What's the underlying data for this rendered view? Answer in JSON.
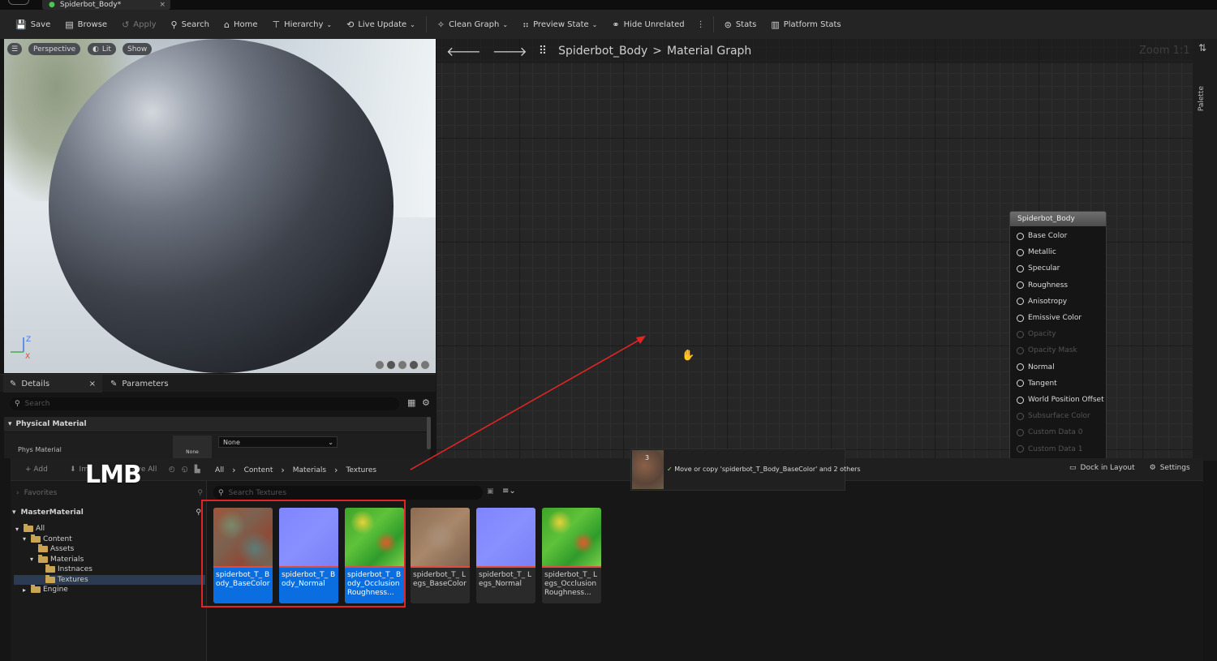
{
  "window": {
    "tab_title": "Spiderbot_Body*",
    "tab_close": "×"
  },
  "toolbar": [
    {
      "label": "Save",
      "icon": "save-icon",
      "enabled": true
    },
    {
      "label": "Browse",
      "icon": "browse-icon",
      "enabled": true
    },
    {
      "label": "Apply",
      "icon": "apply-icon",
      "enabled": false
    },
    {
      "label": "Search",
      "icon": "search-icon",
      "enabled": true
    },
    {
      "label": "Home",
      "icon": "home-icon",
      "enabled": true
    },
    {
      "label": "Hierarchy",
      "icon": "hierarchy-icon",
      "enabled": true,
      "dropdown": true
    },
    {
      "label": "Live Update",
      "icon": "live-update-icon",
      "enabled": true,
      "dropdown": true
    },
    {
      "label": "Clean Graph",
      "icon": "clean-graph-icon",
      "enabled": true,
      "dropdown": true
    },
    {
      "label": "Preview State",
      "icon": "preview-state-icon",
      "enabled": true,
      "dropdown": true
    },
    {
      "label": "Hide Unrelated",
      "icon": "hide-unrelated-icon",
      "enabled": true
    },
    {
      "label": "Stats",
      "icon": "stats-icon",
      "enabled": true
    },
    {
      "label": "Platform Stats",
      "icon": "platform-stats-icon",
      "enabled": true
    }
  ],
  "viewport": {
    "perspective": "Perspective",
    "lit": "Lit",
    "show": "Show",
    "axis_z": "Z",
    "axis_x": "X"
  },
  "details": {
    "tab_details": "Details",
    "tab_close": "×",
    "tab_parameters": "Parameters",
    "search_placeholder": "Search",
    "section": "Physical Material",
    "row_label": "Phys Material",
    "row_thumb": "None",
    "row_value": "None"
  },
  "graph": {
    "crumb_asset": "Spiderbot_Body",
    "crumb_sep": ">",
    "crumb_graph": "Material Graph",
    "zoom": "Zoom 1:1",
    "palette": "Palette"
  },
  "node": {
    "title": "Spiderbot_Body",
    "pins": [
      {
        "label": "Base Color",
        "enabled": true
      },
      {
        "label": "Metallic",
        "enabled": true
      },
      {
        "label": "Specular",
        "enabled": true
      },
      {
        "label": "Roughness",
        "enabled": true
      },
      {
        "label": "Anisotropy",
        "enabled": true
      },
      {
        "label": "Emissive Color",
        "enabled": true
      },
      {
        "label": "Opacity",
        "enabled": false
      },
      {
        "label": "Opacity Mask",
        "enabled": false
      },
      {
        "label": "Normal",
        "enabled": true
      },
      {
        "label": "Tangent",
        "enabled": true
      },
      {
        "label": "World Position Offset",
        "enabled": true
      },
      {
        "label": "Subsurface Color",
        "enabled": false
      },
      {
        "label": "Custom Data 0",
        "enabled": false
      },
      {
        "label": "Custom Data 1",
        "enabled": false
      }
    ]
  },
  "content_browser": {
    "add": "+ Add",
    "import": "Im",
    "save_all": "ave All",
    "crumbs": [
      "All",
      "Content",
      "Materials",
      "Textures"
    ],
    "dock": "Dock in Layout",
    "settings": "Settings",
    "favorites": "Favorites",
    "master": "MasterMaterial",
    "search_placeholder": "Search Textures",
    "tree": [
      {
        "label": "All",
        "depth": 0,
        "open": true
      },
      {
        "label": "Content",
        "depth": 1,
        "open": true
      },
      {
        "label": "Assets",
        "depth": 2
      },
      {
        "label": "Materials",
        "depth": 2,
        "open": true
      },
      {
        "label": "Instnaces",
        "depth": 3
      },
      {
        "label": "Textures",
        "depth": 3,
        "selected": true
      },
      {
        "label": "Engine",
        "depth": 1,
        "collapsed": true
      }
    ],
    "assets": [
      {
        "name": "spiderbot_T_ Body_BaseColor",
        "selected": true,
        "thumb": "base"
      },
      {
        "name": "spiderbot_T_ Body_Normal",
        "selected": true,
        "thumb": "normal"
      },
      {
        "name": "spiderbot_T_ Body_Occlusion Roughness...",
        "selected": true,
        "thumb": "orm"
      },
      {
        "name": "spiderbot_T_ Legs_BaseColor",
        "selected": false,
        "thumb": "legbase"
      },
      {
        "name": "spiderbot_T_ Legs_Normal",
        "selected": false,
        "thumb": "normal"
      },
      {
        "name": "spiderbot_T_ Legs_Occlusion Roughness...",
        "selected": false,
        "thumb": "orm"
      }
    ]
  },
  "drag": {
    "count": "3",
    "check": "✓",
    "message": "Move or copy 'spiderbot_T_Body_BaseColor' and 2 others"
  },
  "overlay": {
    "lmb": "LMB"
  },
  "colors": {
    "selection": "#0b6ee0",
    "annotation_red": "#e32424"
  }
}
